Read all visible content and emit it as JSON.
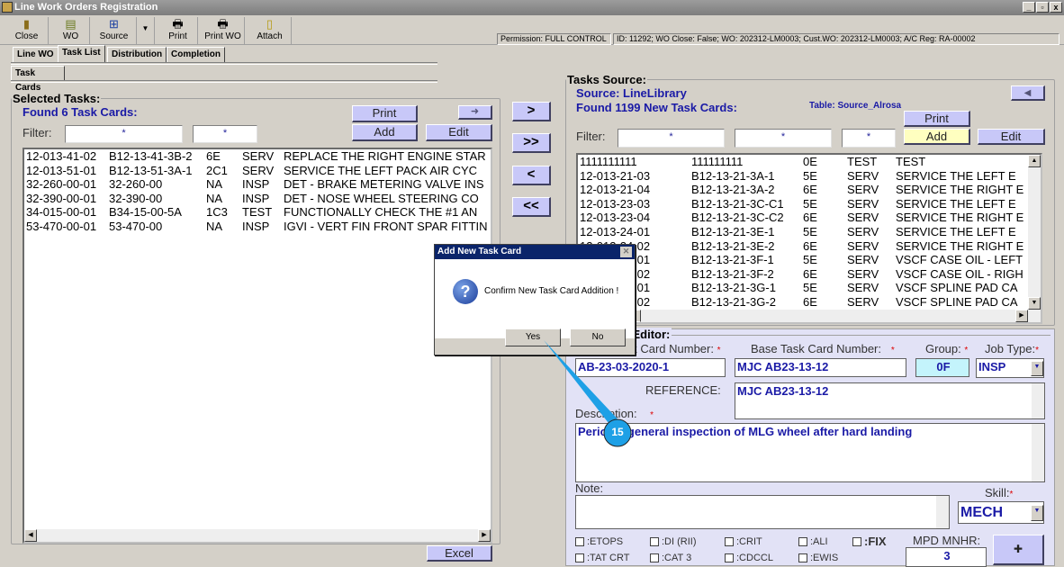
{
  "window": {
    "title": "Line Work Orders Registration",
    "controls": [
      "_",
      "▫",
      "x"
    ]
  },
  "toolbar": [
    {
      "label": "Close",
      "icon": "door-exit-icon"
    },
    {
      "label": "WO",
      "icon": "wo-icon"
    },
    {
      "label": "Source",
      "icon": "source-icon"
    },
    {
      "label": "Print",
      "icon": "printer-icon"
    },
    {
      "label": "Print WO",
      "icon": "printer-icon"
    },
    {
      "label": "Attach",
      "icon": "attach-icon"
    }
  ],
  "status": {
    "permission_label": "Permission:",
    "permission_value": "FULL CONTROL",
    "info": "ID: 11292; WO Close: False; WO: 202312-LM0003; Cust.WO: 202312-LM0003; A/C Reg: RA-00002"
  },
  "tabs": [
    "Line WO",
    "Task List",
    "Distribution",
    "Completion"
  ],
  "subtabs": [
    "Task Cards"
  ],
  "selected": {
    "legend": "Selected Tasks:",
    "found": "Found 6 Task Cards:",
    "filter_label": "Filter:",
    "filters": [
      "*",
      "*"
    ],
    "print": "Print",
    "add": "Add",
    "edit": "Edit",
    "arrow": "➜",
    "excel": "Excel",
    "rows": [
      [
        "12-013-41-02",
        "B12-13-41-3B-2",
        "6E",
        "SERV",
        "REPLACE THE RIGHT ENGINE STAR"
      ],
      [
        "12-013-51-01",
        "B12-13-51-3A-1",
        "2C1",
        "SERV",
        "SERVICE THE LEFT PACK AIR CYC"
      ],
      [
        "32-260-00-01",
        "32-260-00",
        "NA",
        "INSP",
        "DET - BRAKE METERING VALVE INS"
      ],
      [
        "32-390-00-01",
        "32-390-00",
        "NA",
        "INSP",
        "DET - NOSE WHEEL STEERING CO"
      ],
      [
        "34-015-00-01",
        "B34-15-00-5A",
        "1C3",
        "TEST",
        "FUNCTIONALLY CHECK THE  #1 AN"
      ],
      [
        "53-470-00-01",
        "53-470-00",
        "NA",
        "INSP",
        "IGVI - VERT FIN FRONT SPAR FITTIN"
      ]
    ]
  },
  "move": [
    ">",
    ">>",
    "<",
    "<<"
  ],
  "source": {
    "legend": "Tasks Source:",
    "source": "Source: LineLibrary",
    "found": "Found 1199 New Task Cards:",
    "table": "Table: Source_Alrosa",
    "filter_label": "Filter:",
    "filters": [
      "*",
      "*",
      "*"
    ],
    "print": "Print",
    "add": "Add",
    "edit": "Edit",
    "arrow": "◀",
    "rows": [
      [
        "1111111111",
        "111111111",
        "0E",
        "TEST",
        "TEST"
      ],
      [
        "12-013-21-03",
        "B12-13-21-3A-1",
        "5E",
        "SERV",
        "SERVICE THE LEFT E"
      ],
      [
        "12-013-21-04",
        "B12-13-21-3A-2",
        "6E",
        "SERV",
        "SERVICE THE RIGHT E"
      ],
      [
        "12-013-23-03",
        "B12-13-21-3C-C1",
        "5E",
        "SERV",
        "SERVICE THE LEFT E"
      ],
      [
        "12-013-23-04",
        "B12-13-21-3C-C2",
        "6E",
        "SERV",
        "SERVICE THE RIGHT E"
      ],
      [
        "12-013-24-01",
        "B12-13-21-3E-1",
        "5E",
        "SERV",
        "SERVICE THE LEFT E"
      ],
      [
        "12-013-24-02",
        "B12-13-21-3E-2",
        "6E",
        "SERV",
        "SERVICE THE RIGHT E"
      ],
      [
        "12-013-25-01",
        "B12-13-21-3F-1",
        "5E",
        "SERV",
        "VSCF CASE OIL - LEFT"
      ],
      [
        "12-013-25-02",
        "B12-13-21-3F-2",
        "6E",
        "SERV",
        "VSCF CASE OIL - RIGH"
      ],
      [
        "12-013-26-01",
        "B12-13-21-3G-1",
        "5E",
        "SERV",
        "VSCF SPLINE PAD CA"
      ],
      [
        "12-013-26-02",
        "B12-13-21-3G-2",
        "6E",
        "SERV",
        "VSCF SPLINE PAD CA"
      ]
    ]
  },
  "editor": {
    "legend": "Task Card Editor:",
    "tc_label": "Task Card Number:",
    "tc_value": "AB-23-03-2020-1",
    "base_label": "Base Task Card Number:",
    "base_value": "MJC AB23-13-12",
    "group_label": "Group:",
    "group_value": "0F",
    "jobtype_label": "Job Type:",
    "jobtype_value": "INSP",
    "ref_label": "REFERENCE:",
    "ref_value": "MJC AB23-13-12",
    "desc_label": "Description:",
    "desc_value": "Periodic general inspection of MLG wheel after hard landing",
    "note_label": "Note:",
    "note_value": "",
    "skill_label": "Skill:",
    "skill_value": "MECH",
    "mnhr_label": "MPD MNHR:",
    "mnhr_value": "3",
    "checkboxes": [
      ":ETOPS",
      ":DI (RII)",
      ":CRIT",
      ":ALI",
      ":FIX",
      ":TAT CRT",
      ":CAT 3",
      ":CDCCL",
      ":EWIS"
    ],
    "add_icon": "✚"
  },
  "dialog": {
    "title": "Add New Task Card",
    "message": "Confirm New Task Card Addition !",
    "yes": "Yes",
    "no": "No",
    "icon": "?"
  },
  "callout": {
    "number": "15",
    "color": "#1ea0e6"
  }
}
